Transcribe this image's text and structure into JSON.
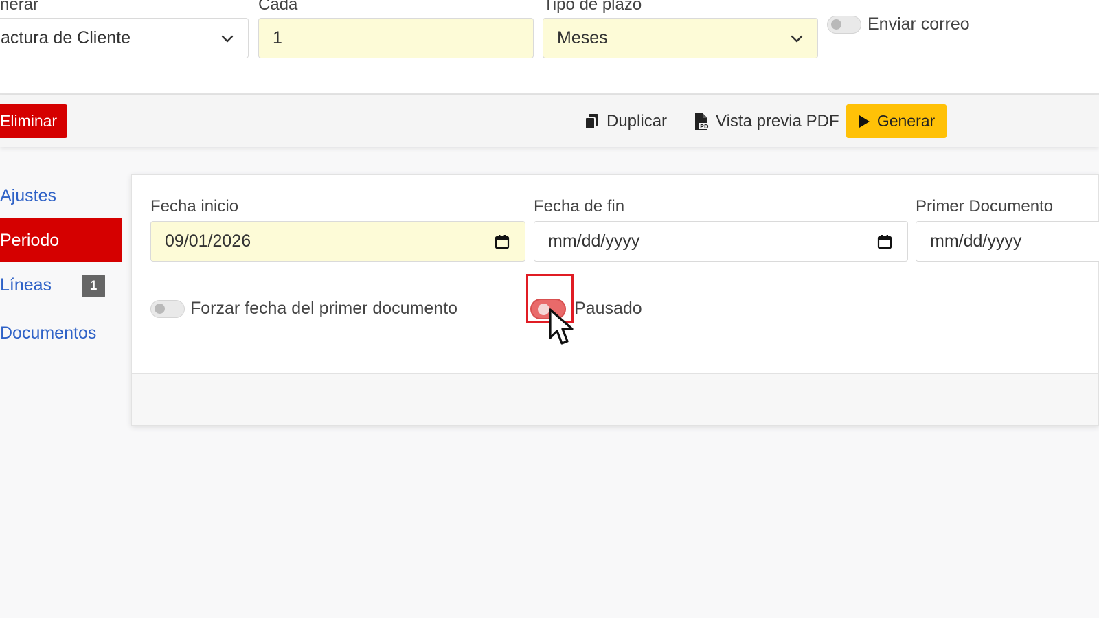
{
  "topform": {
    "generate_label": "nerar",
    "generate_value": "actura de Cliente",
    "every_label": "Cada",
    "every_value": "1",
    "term_type_label": "Tipo de plazo",
    "term_type_value": "Meses",
    "send_email_label": "Enviar correo"
  },
  "toolbar": {
    "delete_label": "Eliminar",
    "duplicate_label": "Duplicar",
    "pdf_preview_label": "Vista previa PDF",
    "generate_label": "Generar"
  },
  "sidebar": {
    "items": [
      {
        "label": "Ajustes"
      },
      {
        "label": "Periodo"
      },
      {
        "label": "Líneas",
        "badge": "1"
      },
      {
        "label": "Documentos"
      }
    ]
  },
  "period": {
    "start_label": "Fecha inicio",
    "start_value": "09/01/2026",
    "end_label": "Fecha de fin",
    "end_placeholder": "mm/dd/yyyy",
    "first_doc_label": "Primer Documento",
    "first_doc_placeholder": "mm/dd/yyyy",
    "force_label": "Forzar fecha del primer documento",
    "paused_label": "Pausado"
  },
  "colors": {
    "danger": "#d50000",
    "warning": "#ffc107",
    "link": "#2f62c7",
    "field_highlight": "#fdfbd7"
  }
}
